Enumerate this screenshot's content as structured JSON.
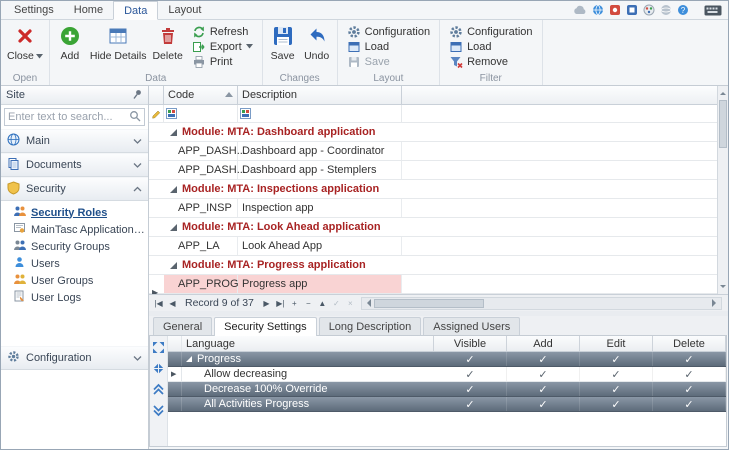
{
  "ribbon": {
    "tabs": [
      "Settings",
      "Home",
      "Data",
      "Layout"
    ],
    "active_tab": "Data",
    "open": {
      "label": "Open",
      "close": "Close"
    },
    "data": {
      "label": "Data",
      "add": "Add",
      "hide_details": "Hide Details",
      "delete": "Delete",
      "refresh": "Refresh",
      "export": "Export",
      "print": "Print"
    },
    "changes": {
      "label": "Changes",
      "save": "Save",
      "undo": "Undo"
    },
    "layout": {
      "label": "Layout",
      "configuration": "Configuration",
      "load": "Load",
      "save": "Save"
    },
    "filter": {
      "label": "Filter",
      "configuration": "Configuration",
      "load": "Load",
      "remove": "Remove"
    }
  },
  "window_toolbar_icons": [
    "cloud",
    "globe",
    "app-red",
    "app-blue",
    "palette",
    "sphere",
    "help",
    "keyboard"
  ],
  "sidebar": {
    "title": "Site",
    "search_placeholder": "Enter text to search...",
    "sections": [
      {
        "label": "Main"
      },
      {
        "label": "Documents"
      },
      {
        "label": "Security",
        "items": [
          "Security Roles",
          "MainTasc Applications Licen...",
          "Security Groups",
          "Users",
          "User Groups",
          "User Logs"
        ],
        "selected_item": "Security Roles"
      },
      {
        "label": "Configuration"
      }
    ]
  },
  "grid": {
    "columns": {
      "code": "Code",
      "description": "Description"
    },
    "groups": [
      {
        "label": "Module: MTA: Dashboard application",
        "rows": [
          {
            "code": "APP_DASH...",
            "description": "Dashboard app - Coordinator"
          },
          {
            "code": "APP_DASH...",
            "description": "Dashboard app - Stemplers"
          }
        ]
      },
      {
        "label": "Module: MTA: Inspections application",
        "rows": [
          {
            "code": "APP_INSP",
            "description": "Inspection app"
          }
        ]
      },
      {
        "label": "Module: MTA: Look Ahead application",
        "rows": [
          {
            "code": "APP_LA",
            "description": "Look Ahead App"
          }
        ]
      },
      {
        "label": "Module: MTA: Progress application",
        "rows": [
          {
            "code": "APP_PROG",
            "description": "Progress app"
          }
        ]
      }
    ],
    "selected_row_code": "APP_PROG",
    "navigator": {
      "record_label": "Record 9 of 37",
      "buttons": [
        "|◀",
        "◀",
        "▶",
        "▶|",
        "+",
        "−",
        "▲",
        "✓",
        "×"
      ]
    }
  },
  "details": {
    "tabs": [
      "General",
      "Security Settings",
      "Long Description",
      "Assigned Users"
    ],
    "active_tab": "Security Settings",
    "grid": {
      "columns": [
        "Language",
        "Visible",
        "Add",
        "Edit",
        "Delete"
      ],
      "rows": [
        {
          "language": "Progress",
          "visible": true,
          "add": true,
          "edit": true,
          "delete": true
        },
        {
          "language": "Allow decreasing",
          "visible": true,
          "add": true,
          "edit": true,
          "delete": true
        },
        {
          "language": "Decrease 100% Override",
          "visible": true,
          "add": true,
          "edit": true,
          "delete": true
        },
        {
          "language": "All Activities Progress",
          "visible": true,
          "add": true,
          "edit": true,
          "delete": true
        }
      ]
    }
  },
  "colors": {
    "group_row_text": "#a82323",
    "selected_row_bg": "#f9d3d3",
    "accent_blue": "#3d7bc4",
    "dark_row_top": "#8a97a6",
    "dark_row_bottom": "#5d6b7a"
  }
}
